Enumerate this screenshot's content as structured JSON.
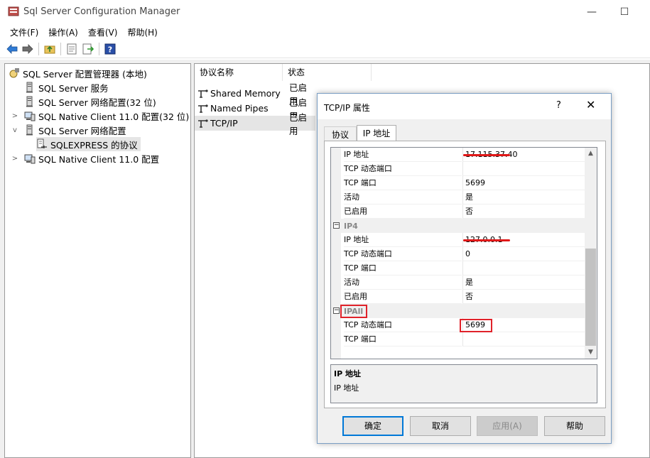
{
  "window": {
    "title": "Sql Server Configuration Manager",
    "minimize_glyph": "—",
    "maximize_glyph": "☐"
  },
  "menu": [
    "文件(F)",
    "操作(A)",
    "查看(V)",
    "帮助(H)"
  ],
  "toolbar_icons": [
    "back-arrow-icon",
    "forward-arrow-icon",
    "up-folder-icon",
    "properties-icon",
    "export-list-icon",
    "help-icon"
  ],
  "tree": [
    {
      "label": "SQL Server 配置管理器 (本地)",
      "icon": "config-manager-icon",
      "expander": ""
    },
    {
      "label": "SQL Server 服务",
      "icon": "server-icon",
      "expander": ""
    },
    {
      "label": "SQL Server 网络配置(32 位)",
      "icon": "server-icon",
      "expander": ""
    },
    {
      "label": "SQL Native Client 11.0 配置(32 位)",
      "icon": "client-icon",
      "expander": ">"
    },
    {
      "label": "SQL Server 网络配置",
      "icon": "server-icon",
      "expander": "v"
    },
    {
      "label": "SQLEXPRESS 的协议",
      "icon": "protocol-icon",
      "expander": ""
    },
    {
      "label": "SQL Native Client 11.0 配置",
      "icon": "client-icon",
      "expander": ">"
    }
  ],
  "listview": {
    "columns": [
      "协议名称",
      "状态"
    ],
    "rows": [
      {
        "name": "Shared Memory",
        "state": "已启用"
      },
      {
        "name": "Named Pipes",
        "state": "已启用"
      },
      {
        "name": "TCP/IP",
        "state": "已启用"
      }
    ]
  },
  "dialog": {
    "title": "TCP/IP 属性",
    "help_glyph": "?",
    "close_glyph": "✕",
    "tabs": [
      "协议",
      "IP 地址"
    ],
    "grid": [
      {
        "type": "prop",
        "label": "IP 地址",
        "value": "17.115.37.40",
        "redacted": true
      },
      {
        "type": "prop",
        "label": "TCP 动态端口",
        "value": ""
      },
      {
        "type": "prop",
        "label": "TCP 端口",
        "value": "5699"
      },
      {
        "type": "prop",
        "label": "活动",
        "value": "是"
      },
      {
        "type": "prop",
        "label": "已启用",
        "value": "否"
      },
      {
        "type": "cat",
        "label": "IP4",
        "toggle": "−"
      },
      {
        "type": "prop",
        "label": "IP 地址",
        "value": "127.0.0.1",
        "redacted": true
      },
      {
        "type": "prop",
        "label": "TCP 动态端口",
        "value": "0"
      },
      {
        "type": "prop",
        "label": "TCP 端口",
        "value": ""
      },
      {
        "type": "prop",
        "label": "活动",
        "value": "是"
      },
      {
        "type": "prop",
        "label": "已启用",
        "value": "否"
      },
      {
        "type": "cat",
        "label": "IPAll",
        "toggle": "−"
      },
      {
        "type": "prop",
        "label": "TCP 动态端口",
        "value": "5699"
      },
      {
        "type": "prop",
        "label": "TCP 端口",
        "value": ""
      }
    ],
    "scroll_up_glyph": "▲",
    "scroll_down_glyph": "▼",
    "description": {
      "title": "IP 地址",
      "text": "IP 地址"
    },
    "buttons": {
      "ok": "确定",
      "cancel": "取消",
      "apply": "应用(A)",
      "help": "帮助"
    }
  },
  "colors": {
    "accent": "#0078d7",
    "annotation_red": "#e0222a"
  }
}
